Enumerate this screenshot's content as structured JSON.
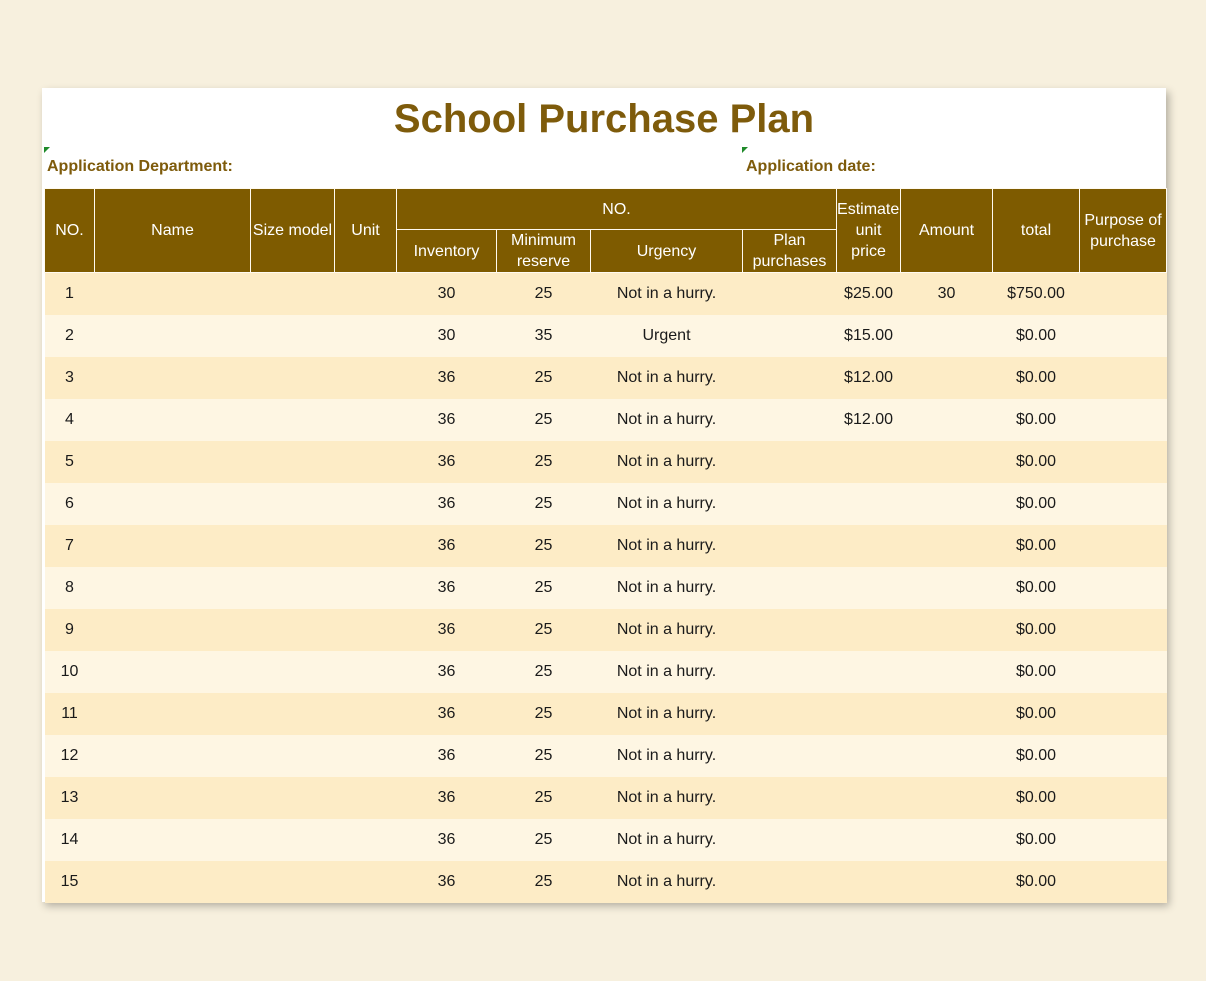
{
  "title": "School Purchase Plan",
  "labels": {
    "department": "Application Department:",
    "date": "Application date:"
  },
  "headers": {
    "no": "NO.",
    "name": "Name",
    "size_model": "Size model",
    "unit": "Unit",
    "group": "NO.",
    "inventory": "Inventory",
    "minimum_reserve": "Minimum reserve",
    "urgency": "Urgency",
    "plan_purchases": "Plan purchases",
    "est_unit_price": "Estimated unit price",
    "amount": "Amount",
    "total": "total",
    "purpose": "Purpose of purchase"
  },
  "rows": [
    {
      "no": "1",
      "name": "",
      "size": "",
      "unit": "",
      "inventory": "30",
      "min_reserve": "25",
      "urgency": "Not in a hurry.",
      "plan": "",
      "price": "$25.00",
      "amount": "30",
      "total": "$750.00",
      "purpose": ""
    },
    {
      "no": "2",
      "name": "",
      "size": "",
      "unit": "",
      "inventory": "30",
      "min_reserve": "35",
      "urgency": "Urgent",
      "plan": "",
      "price": "$15.00",
      "amount": "",
      "total": "$0.00",
      "purpose": ""
    },
    {
      "no": "3",
      "name": "",
      "size": "",
      "unit": "",
      "inventory": "36",
      "min_reserve": "25",
      "urgency": "Not in a hurry.",
      "plan": "",
      "price": "$12.00",
      "amount": "",
      "total": "$0.00",
      "purpose": ""
    },
    {
      "no": "4",
      "name": "",
      "size": "",
      "unit": "",
      "inventory": "36",
      "min_reserve": "25",
      "urgency": "Not in a hurry.",
      "plan": "",
      "price": "$12.00",
      "amount": "",
      "total": "$0.00",
      "purpose": ""
    },
    {
      "no": "5",
      "name": "",
      "size": "",
      "unit": "",
      "inventory": "36",
      "min_reserve": "25",
      "urgency": "Not in a hurry.",
      "plan": "",
      "price": "",
      "amount": "",
      "total": "$0.00",
      "purpose": ""
    },
    {
      "no": "6",
      "name": "",
      "size": "",
      "unit": "",
      "inventory": "36",
      "min_reserve": "25",
      "urgency": "Not in a hurry.",
      "plan": "",
      "price": "",
      "amount": "",
      "total": "$0.00",
      "purpose": ""
    },
    {
      "no": "7",
      "name": "",
      "size": "",
      "unit": "",
      "inventory": "36",
      "min_reserve": "25",
      "urgency": "Not in a hurry.",
      "plan": "",
      "price": "",
      "amount": "",
      "total": "$0.00",
      "purpose": ""
    },
    {
      "no": "8",
      "name": "",
      "size": "",
      "unit": "",
      "inventory": "36",
      "min_reserve": "25",
      "urgency": "Not in a hurry.",
      "plan": "",
      "price": "",
      "amount": "",
      "total": "$0.00",
      "purpose": ""
    },
    {
      "no": "9",
      "name": "",
      "size": "",
      "unit": "",
      "inventory": "36",
      "min_reserve": "25",
      "urgency": "Not in a hurry.",
      "plan": "",
      "price": "",
      "amount": "",
      "total": "$0.00",
      "purpose": ""
    },
    {
      "no": "10",
      "name": "",
      "size": "",
      "unit": "",
      "inventory": "36",
      "min_reserve": "25",
      "urgency": "Not in a hurry.",
      "plan": "",
      "price": "",
      "amount": "",
      "total": "$0.00",
      "purpose": ""
    },
    {
      "no": "11",
      "name": "",
      "size": "",
      "unit": "",
      "inventory": "36",
      "min_reserve": "25",
      "urgency": "Not in a hurry.",
      "plan": "",
      "price": "",
      "amount": "",
      "total": "$0.00",
      "purpose": ""
    },
    {
      "no": "12",
      "name": "",
      "size": "",
      "unit": "",
      "inventory": "36",
      "min_reserve": "25",
      "urgency": "Not in a hurry.",
      "plan": "",
      "price": "",
      "amount": "",
      "total": "$0.00",
      "purpose": ""
    },
    {
      "no": "13",
      "name": "",
      "size": "",
      "unit": "",
      "inventory": "36",
      "min_reserve": "25",
      "urgency": "Not in a hurry.",
      "plan": "",
      "price": "",
      "amount": "",
      "total": "$0.00",
      "purpose": ""
    },
    {
      "no": "14",
      "name": "",
      "size": "",
      "unit": "",
      "inventory": "36",
      "min_reserve": "25",
      "urgency": "Not in a hurry.",
      "plan": "",
      "price": "",
      "amount": "",
      "total": "$0.00",
      "purpose": ""
    },
    {
      "no": "15",
      "name": "",
      "size": "",
      "unit": "",
      "inventory": "36",
      "min_reserve": "25",
      "urgency": "Not in a hurry.",
      "plan": "",
      "price": "",
      "amount": "",
      "total": "$0.00",
      "purpose": ""
    }
  ],
  "colors": {
    "header_bg": "#7e5b00",
    "title_text": "#7e5b0b",
    "row_odd": "#fdecc6",
    "row_even": "#fef6e3",
    "page_bg": "#f7f0de"
  }
}
